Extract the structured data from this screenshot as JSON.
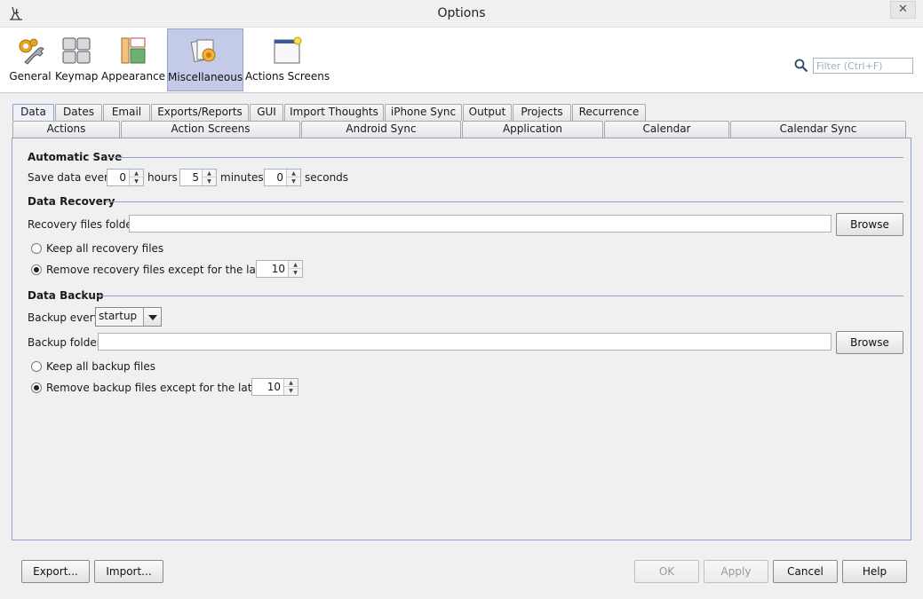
{
  "window": {
    "title": "Options"
  },
  "categories": [
    {
      "label": "General",
      "icon": "gears-wrench-icon"
    },
    {
      "label": "Keymap",
      "icon": "keyboard-keys-icon"
    },
    {
      "label": "Appearance",
      "icon": "appearance-layout-icon"
    },
    {
      "label": "Miscellaneous",
      "icon": "misc-flower-icon",
      "selected": true
    },
    {
      "label": "Actions Screens",
      "icon": "window-star-icon"
    }
  ],
  "filter": {
    "placeholder": "Filter (Ctrl+F)"
  },
  "tabs_row1": [
    "Data",
    "Dates",
    "Email",
    "Exports/Reports",
    "GUI",
    "Import Thoughts",
    "iPhone Sync",
    "Output",
    "Projects",
    "Recurrence"
  ],
  "tabs_row2": [
    "Actions",
    "Action Screens",
    "Android Sync",
    "Application",
    "Calendar",
    "Calendar Sync"
  ],
  "selected_tab": "Data",
  "autosave": {
    "title": "Automatic Save",
    "prefix": "Save data every",
    "hours_value": "0",
    "hours_label": "hours",
    "minutes_value": "5",
    "minutes_label": "minutes",
    "seconds_value": "0",
    "seconds_label": "seconds"
  },
  "recovery": {
    "title": "Data Recovery",
    "folder_label": "Recovery files folder",
    "browse_label": "Browse",
    "keep_all_label": "Keep all recovery files",
    "remove_label": "Remove recovery files except for the latest",
    "latest_value": "10",
    "selected_option": "remove"
  },
  "backup": {
    "title": "Data Backup",
    "every_label": "Backup every",
    "every_value": "startup",
    "folder_label": "Backup folder",
    "browse_label": "Browse",
    "keep_all_label": "Keep all backup files",
    "remove_label": "Remove backup files except for the latest",
    "latest_value": "10",
    "selected_option": "remove"
  },
  "footer": {
    "export_label": "Export...",
    "import_label": "Import...",
    "ok_label": "OK",
    "apply_label": "Apply",
    "cancel_label": "Cancel",
    "help_label": "Help"
  }
}
